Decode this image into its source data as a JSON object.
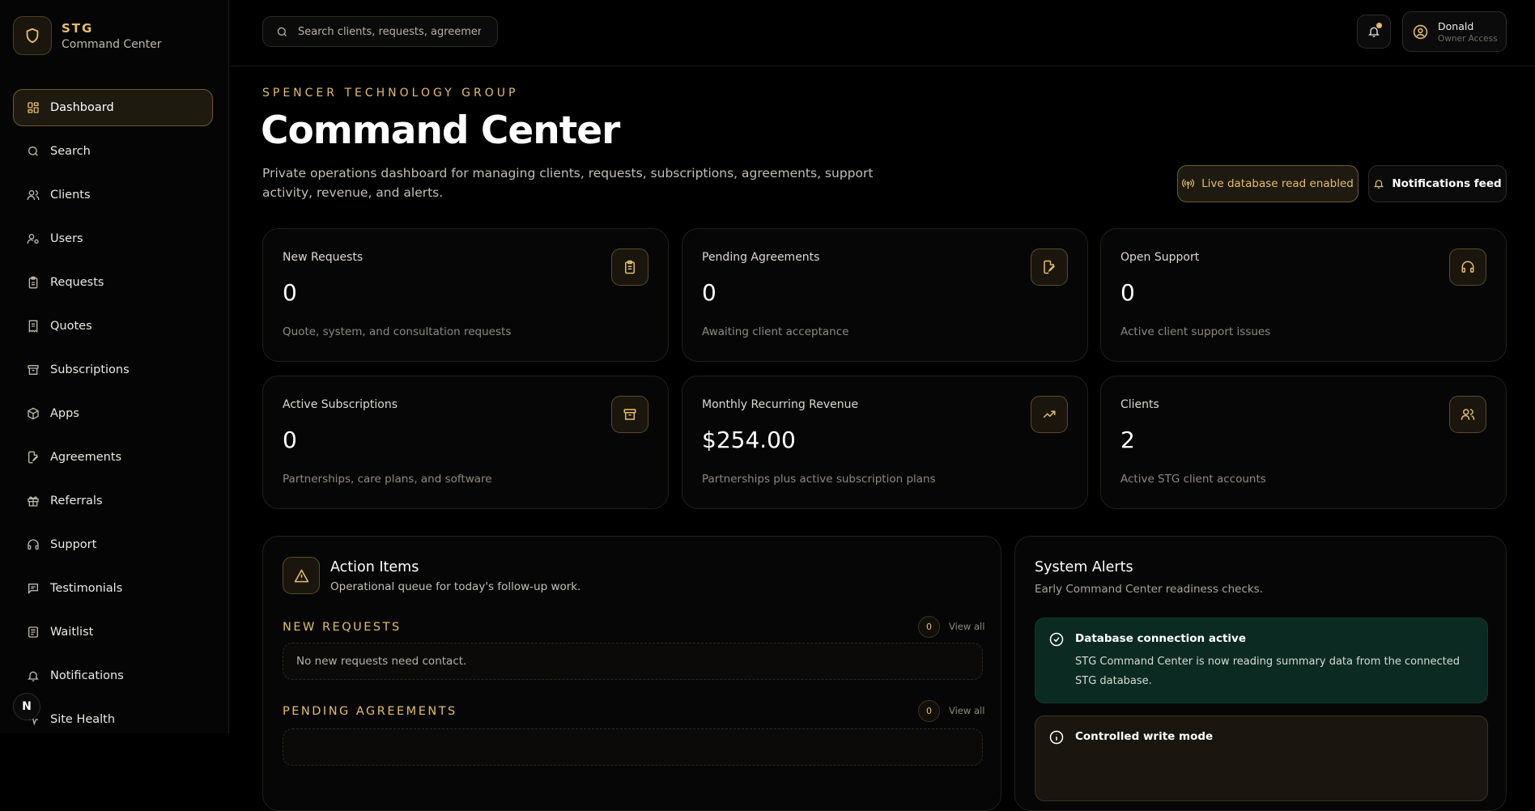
{
  "brand": {
    "name": "STG",
    "subtitle": "Command Center",
    "icon": "shield-icon"
  },
  "sidebar": {
    "items": [
      {
        "label": "Dashboard",
        "icon": "dashboard-icon",
        "active": true
      },
      {
        "label": "Search",
        "icon": "search-icon"
      },
      {
        "label": "Clients",
        "icon": "users-icon"
      },
      {
        "label": "Users",
        "icon": "user-cog-icon"
      },
      {
        "label": "Requests",
        "icon": "clipboard-icon"
      },
      {
        "label": "Quotes",
        "icon": "receipt-icon"
      },
      {
        "label": "Subscriptions",
        "icon": "archive-icon"
      },
      {
        "label": "Apps",
        "icon": "package-icon"
      },
      {
        "label": "Agreements",
        "icon": "file-pen-icon"
      },
      {
        "label": "Referrals",
        "icon": "gift-icon"
      },
      {
        "label": "Support",
        "icon": "headset-icon"
      },
      {
        "label": "Testimonials",
        "icon": "message-square-icon"
      },
      {
        "label": "Waitlist",
        "icon": "inbox-list-icon"
      },
      {
        "label": "Notifications",
        "icon": "bell-icon"
      },
      {
        "label": "Site Health",
        "icon": "activity-icon"
      }
    ],
    "badge": "N"
  },
  "topbar": {
    "search_placeholder": "Search clients, requests, agreements...",
    "user_name": "Donald",
    "user_role": "Owner Access"
  },
  "header": {
    "eyebrow": "SPENCER TECHNOLOGY GROUP",
    "title": "Command Center",
    "description": "Private operations dashboard for managing clients, requests, subscriptions, agreements, support activity, revenue, and alerts.",
    "live_label": "Live database read enabled",
    "notifications_label": "Notifications feed"
  },
  "stats": [
    {
      "label": "New Requests",
      "value": "0",
      "sub": "Quote, system, and consultation requests",
      "icon": "clipboard-list-icon"
    },
    {
      "label": "Pending Agreements",
      "value": "0",
      "sub": "Awaiting client acceptance",
      "icon": "file-signature-icon"
    },
    {
      "label": "Open Support",
      "value": "0",
      "sub": "Active client support issues",
      "icon": "headphones-icon"
    },
    {
      "label": "Active Subscriptions",
      "value": "0",
      "sub": "Partnerships, care plans, and software",
      "icon": "archive-box-icon"
    },
    {
      "label": "Monthly Recurring Revenue",
      "value": "$254.00",
      "sub": "Partnerships plus active subscription plans",
      "icon": "trending-up-icon"
    },
    {
      "label": "Clients",
      "value": "2",
      "sub": "Active STG client accounts",
      "icon": "users-icon"
    }
  ],
  "action_items": {
    "title": "Action Items",
    "subtitle": "Operational queue for today's follow-up work.",
    "sections": [
      {
        "heading": "NEW REQUESTS",
        "count": "0",
        "view_all": "View all",
        "empty": "No new requests need contact."
      },
      {
        "heading": "PENDING AGREEMENTS",
        "count": "0",
        "view_all": "View all"
      }
    ]
  },
  "system_alerts": {
    "title": "System Alerts",
    "subtitle": "Early Command Center readiness checks.",
    "alerts": [
      {
        "title": "Database connection active",
        "text": "STG Command Center is now reading summary data from the connected STG database.",
        "status": "ok"
      },
      {
        "title": "Controlled write mode",
        "status": "warning"
      }
    ]
  },
  "colors": {
    "accent": "#e4be6a",
    "background": "#000000",
    "ok": "#0a2a22"
  }
}
